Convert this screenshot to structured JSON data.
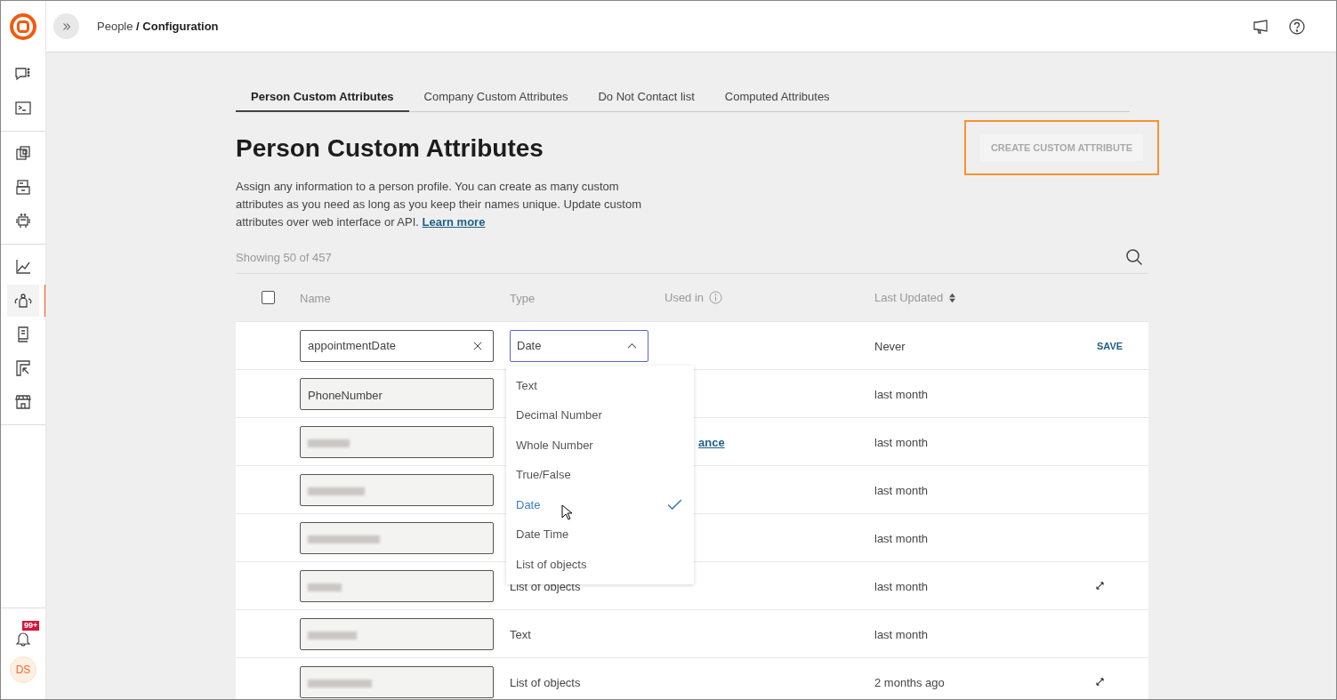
{
  "breadcrumb": {
    "parent": "People",
    "separator": "/",
    "current": "Configuration"
  },
  "sidebar": {
    "items": [
      {
        "selected": false
      },
      {
        "selected": false
      },
      {
        "selected": false
      },
      {
        "selected": false
      },
      {
        "selected": false
      },
      {
        "selected": false
      },
      {
        "selected": true
      },
      {
        "selected": false
      },
      {
        "selected": false
      },
      {
        "selected": false
      }
    ]
  },
  "notifications": {
    "badge": "99+"
  },
  "avatar": {
    "initials": "DS"
  },
  "tabs": [
    {
      "label": "Person Custom Attributes",
      "selected": true
    },
    {
      "label": "Company Custom Attributes",
      "selected": false
    },
    {
      "label": "Do Not Contact list",
      "selected": false
    },
    {
      "label": "Computed Attributes",
      "selected": false
    }
  ],
  "title": "Person Custom Attributes",
  "description": "Assign any information to a person profile. You can create as many custom attributes as you need as long as you keep their names unique. Update custom attributes over web interface or API.",
  "learn_more": "Learn more",
  "create_button": {
    "label": "CREATE CUSTOM ATTRIBUTE",
    "disabled": true,
    "highlighted": true
  },
  "showing": "Showing 50 of 457",
  "select_all": {
    "checked": false
  },
  "columns": [
    "Name",
    "Type",
    "Used in",
    "Last Updated"
  ],
  "editing_row": {
    "name": "appointmentDate",
    "type": "Date",
    "last_updated": "Never",
    "action": "SAVE"
  },
  "type_menu": [
    {
      "label": "Text",
      "selected": false
    },
    {
      "label": "Decimal Number",
      "selected": false
    },
    {
      "label": "Whole Number",
      "selected": false
    },
    {
      "label": "True/False",
      "selected": false
    },
    {
      "label": "Date",
      "selected": true
    },
    {
      "label": "Date Time",
      "selected": false
    },
    {
      "label": "List of objects",
      "selected": false
    }
  ],
  "rows": [
    {
      "name": "PhoneNumber",
      "redacted": false,
      "last_updated": "last month",
      "expandable": false
    },
    {
      "redacted": true,
      "used_in": "ance",
      "last_updated": "last month",
      "expandable": false
    },
    {
      "redacted": true,
      "last_updated": "last month",
      "expandable": false
    },
    {
      "redacted": true,
      "last_updated": "last month",
      "expandable": false
    },
    {
      "redacted": true,
      "type": "List of objects",
      "last_updated": "last month",
      "expandable": true
    },
    {
      "redacted": true,
      "type": "Text",
      "last_updated": "last month",
      "expandable": false
    },
    {
      "redacted": true,
      "type": "List of objects",
      "last_updated": "2 months ago",
      "expandable": true
    }
  ]
}
